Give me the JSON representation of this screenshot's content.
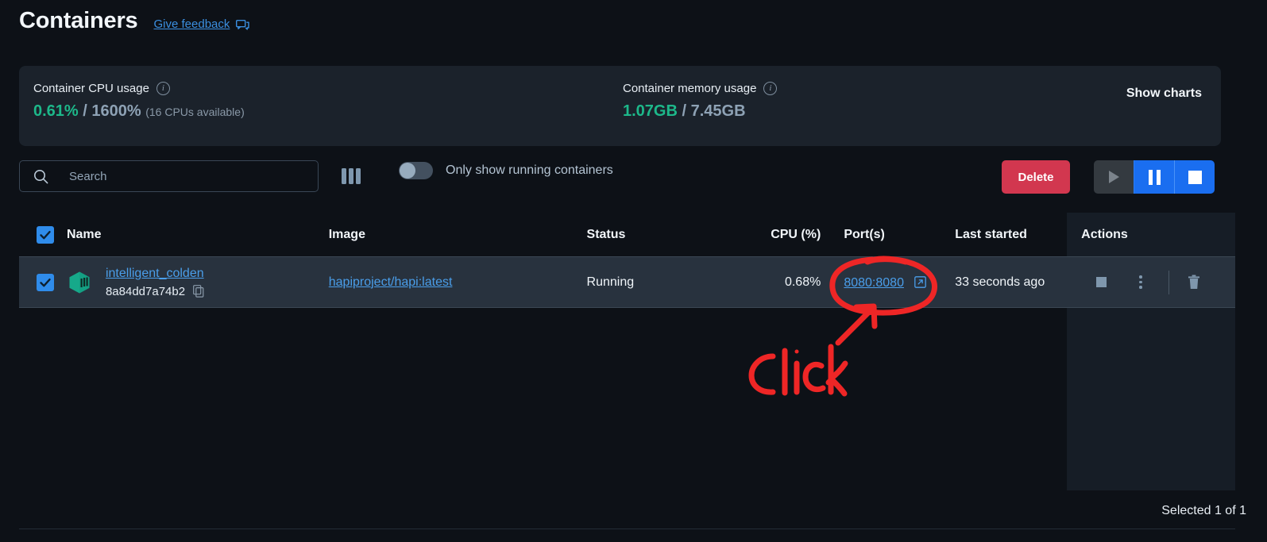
{
  "header": {
    "title": "Containers",
    "feedback_label": "Give feedback",
    "feedback_icon": "chat-bubbles-icon"
  },
  "stats": {
    "cpu": {
      "label": "Container CPU usage",
      "used": "0.61%",
      "separator": " / ",
      "total": "1600%",
      "note": "(16 CPUs available)",
      "info_icon": "info-icon"
    },
    "memory": {
      "label": "Container memory usage",
      "used": "1.07GB",
      "separator": " / ",
      "total": "7.45GB",
      "note": "",
      "info_icon": "info-icon"
    },
    "show_charts_label": "Show charts"
  },
  "toolbar": {
    "search_placeholder": "Search",
    "search_value": "",
    "search_icon": "search-icon",
    "columns_icon": "columns-icon",
    "toggle_label": "Only show running containers",
    "toggle_state": "off",
    "delete_label": "Delete",
    "play_icon": "play-icon",
    "pause_icon": "pause-icon",
    "stop_icon": "stop-icon"
  },
  "table": {
    "headers": {
      "name": "Name",
      "image": "Image",
      "status": "Status",
      "cpu": "CPU (%)",
      "ports": "Port(s)",
      "last_started": "Last started",
      "actions": "Actions"
    },
    "header_checkbox_state": "checked",
    "rows": [
      {
        "checkbox_state": "checked",
        "icon": "container-cube-icon",
        "name": "intelligent_colden",
        "container_id": "8a84dd7a74b2",
        "copy_icon": "copy-icon",
        "image": "hapiproject/hapi:latest",
        "status": "Running",
        "cpu": "0.68%",
        "port": "8080:8080",
        "port_external_icon": "external-link-icon",
        "last_started": "33 seconds ago",
        "actions": {
          "stop_icon": "stop-square-icon",
          "menu_icon": "kebab-menu-icon",
          "delete_icon": "trash-icon"
        }
      }
    ]
  },
  "footer": {
    "selected_text": "Selected 1 of 1"
  },
  "annotation": {
    "text": "click",
    "color": "#ee2626",
    "shape": "ellipse-around-port-link-with-arrow"
  },
  "colors": {
    "page_bg": "#0d1117",
    "panel_bg": "#1b222b",
    "row_bg": "#28323e",
    "actions_col_bg": "#161d26",
    "accent_blue": "#4a9eea",
    "accent_green": "#1db88a",
    "danger_red": "#d2374f",
    "button_blue": "#1a6ef0",
    "annotation_red": "#ee2626"
  }
}
